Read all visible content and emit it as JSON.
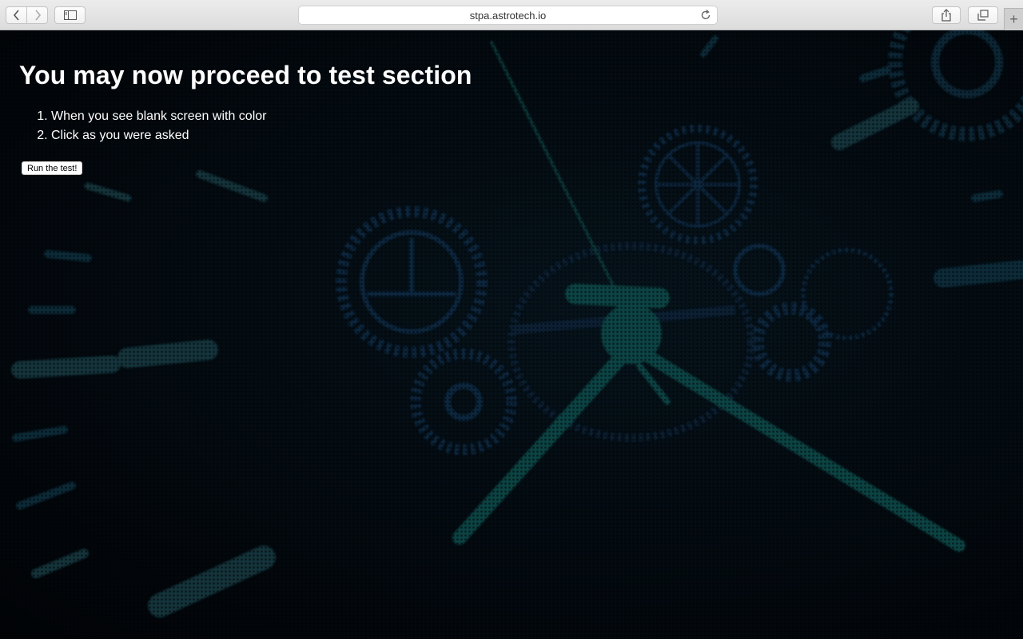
{
  "browser": {
    "url": "stpa.astrotech.io",
    "icons": {
      "back": "chevron-left-icon",
      "forward": "chevron-right-icon",
      "sidebar": "sidebar-icon",
      "reload": "reload-icon",
      "share": "share-icon",
      "tabs": "tabs-overview-icon",
      "new_tab": "plus-icon"
    }
  },
  "page": {
    "heading": "You may now proceed to test section",
    "steps": [
      "When you see blank screen with color",
      "Click as you were asked"
    ],
    "run_button": "Run the test!"
  },
  "colors": {
    "background": "#03090e",
    "clock_hands": "#0f4a48",
    "gears": "#0c2a44"
  }
}
